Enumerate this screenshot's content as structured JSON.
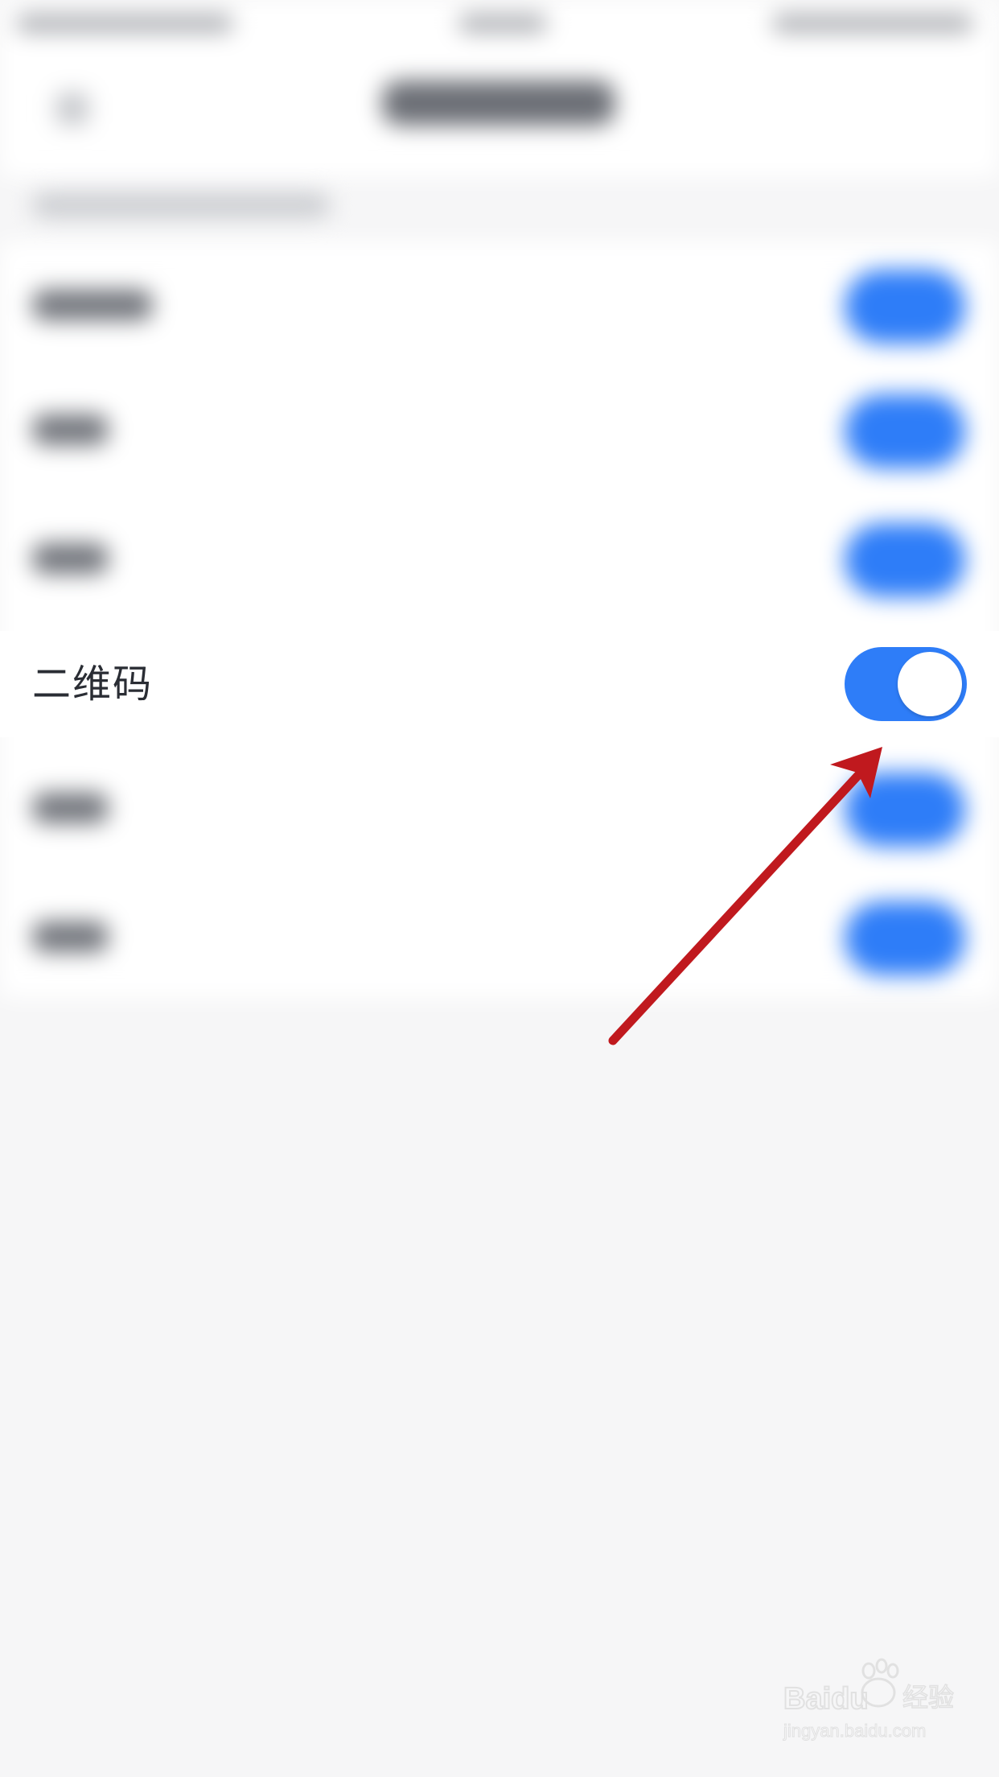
{
  "qr_row": {
    "label": "二维码",
    "toggle_on": true
  },
  "colors": {
    "toggle_on": "#2e7df8",
    "annotation_arrow": "#c0191e",
    "page_background": "#f6f6f7"
  },
  "icons": {
    "annotation": "red-arrow-icon",
    "watermark": "baidu-jingyan-logo"
  },
  "watermark": {
    "brand": "Baidu",
    "product": "经验",
    "url": "jingyan.baidu.com"
  }
}
